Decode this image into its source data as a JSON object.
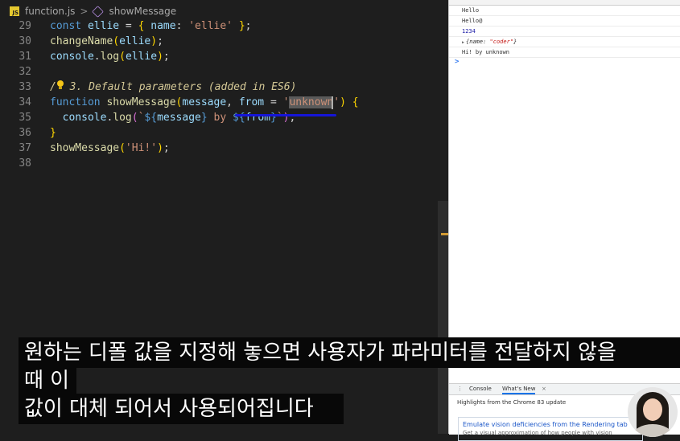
{
  "breadcrumb": {
    "file_icon_label": "JS",
    "file": "function.js",
    "separator": ">",
    "symbol": "showMessage"
  },
  "editor": {
    "lines": [
      {
        "num": "29",
        "tokens": [
          {
            "t": "const ",
            "c": "kw"
          },
          {
            "t": "ellie",
            "c": "var"
          },
          {
            "t": " = ",
            "c": "pn"
          },
          {
            "t": "{",
            "c": "yb"
          },
          {
            "t": " name",
            "c": "var"
          },
          {
            "t": ": ",
            "c": "pn"
          },
          {
            "t": "'ellie'",
            "c": "str"
          },
          {
            "t": " ",
            "c": "pn"
          },
          {
            "t": "}",
            "c": "yb"
          },
          {
            "t": ";",
            "c": "pn"
          }
        ]
      },
      {
        "num": "30",
        "tokens": [
          {
            "t": "changeName",
            "c": "fn"
          },
          {
            "t": "(",
            "c": "yb"
          },
          {
            "t": "ellie",
            "c": "var"
          },
          {
            "t": ")",
            "c": "yb"
          },
          {
            "t": ";",
            "c": "pn"
          }
        ]
      },
      {
        "num": "31",
        "tokens": [
          {
            "t": "console",
            "c": "var"
          },
          {
            "t": ".",
            "c": "pn"
          },
          {
            "t": "log",
            "c": "fn"
          },
          {
            "t": "(",
            "c": "yb"
          },
          {
            "t": "ellie",
            "c": "var"
          },
          {
            "t": ")",
            "c": "yb"
          },
          {
            "t": ";",
            "c": "pn"
          }
        ]
      },
      {
        "num": "32",
        "tokens": []
      },
      {
        "num": "33",
        "tokens": [
          {
            "t": "/",
            "c": "cm"
          },
          {
            "t": "",
            "c": "bulb"
          },
          {
            "t": " 3. Default parameters (added in ES6)",
            "c": "cm"
          }
        ]
      },
      {
        "num": "34",
        "tokens": [
          {
            "t": "function ",
            "c": "kw"
          },
          {
            "t": "showMessage",
            "c": "fn"
          },
          {
            "t": "(",
            "c": "yb"
          },
          {
            "t": "message",
            "c": "var"
          },
          {
            "t": ", ",
            "c": "pn"
          },
          {
            "t": "from",
            "c": "var"
          },
          {
            "t": " = ",
            "c": "pn"
          },
          {
            "t": "'",
            "c": "str"
          },
          {
            "t": "unknown",
            "c": "str hl"
          },
          {
            "t": "'",
            "c": "str"
          },
          {
            "t": ")",
            "c": "yb"
          },
          {
            "t": " ",
            "c": "pn"
          },
          {
            "t": "{",
            "c": "yb"
          }
        ]
      },
      {
        "num": "35",
        "tokens": [
          {
            "t": "  console",
            "c": "var"
          },
          {
            "t": ".",
            "c": "pn"
          },
          {
            "t": "log",
            "c": "fn"
          },
          {
            "t": "(",
            "c": "pb"
          },
          {
            "t": "`",
            "c": "tpl"
          },
          {
            "t": "${",
            "c": "kw"
          },
          {
            "t": "message",
            "c": "var"
          },
          {
            "t": "}",
            "c": "kw"
          },
          {
            "t": " by ",
            "c": "tpl"
          },
          {
            "t": "${",
            "c": "kw"
          },
          {
            "t": "from",
            "c": "var"
          },
          {
            "t": "}",
            "c": "kw"
          },
          {
            "t": "`",
            "c": "tpl"
          },
          {
            "t": ")",
            "c": "pb"
          },
          {
            "t": ";",
            "c": "pn"
          }
        ]
      },
      {
        "num": "36",
        "tokens": [
          {
            "t": "}",
            "c": "yb"
          }
        ]
      },
      {
        "num": "37",
        "tokens": [
          {
            "t": "showMessage",
            "c": "fn"
          },
          {
            "t": "(",
            "c": "yb"
          },
          {
            "t": "'Hi!'",
            "c": "str"
          },
          {
            "t": ")",
            "c": "yb"
          },
          {
            "t": ";",
            "c": "pn"
          }
        ]
      },
      {
        "num": "38",
        "tokens": []
      }
    ]
  },
  "console": {
    "lines": [
      {
        "text": "Hello"
      },
      {
        "text": "Hello@"
      },
      {
        "text": "1234",
        "type": "number"
      },
      {
        "type": "object",
        "prefix": "{name: ",
        "value": "\"coder\"",
        "suffix": "}"
      },
      {
        "text": "Hi! by unknown"
      }
    ],
    "prompt": ">"
  },
  "drawer": {
    "menu_icon": "⋮",
    "tabs": [
      "Console",
      "What's New"
    ],
    "close": "×",
    "highlights": "Highlights from the Chrome 83 update",
    "card_title": "Emulate vision deficiencies from the Rendering tab",
    "card_desc": "Get a visual approximation of how people with vision"
  },
  "subtitles": [
    "원하는 디폴 값을 지정해 놓으면 사용자가 파라미터를 전달하지 않을",
    "때 이",
    "값이 대체 되어서 사용되어집니다"
  ],
  "colors": {
    "editor_bg": "#1e1e1e",
    "keyword": "#569cd6",
    "function": "#dcdcaa",
    "string": "#ce9178",
    "variable": "#9cdcfe"
  }
}
